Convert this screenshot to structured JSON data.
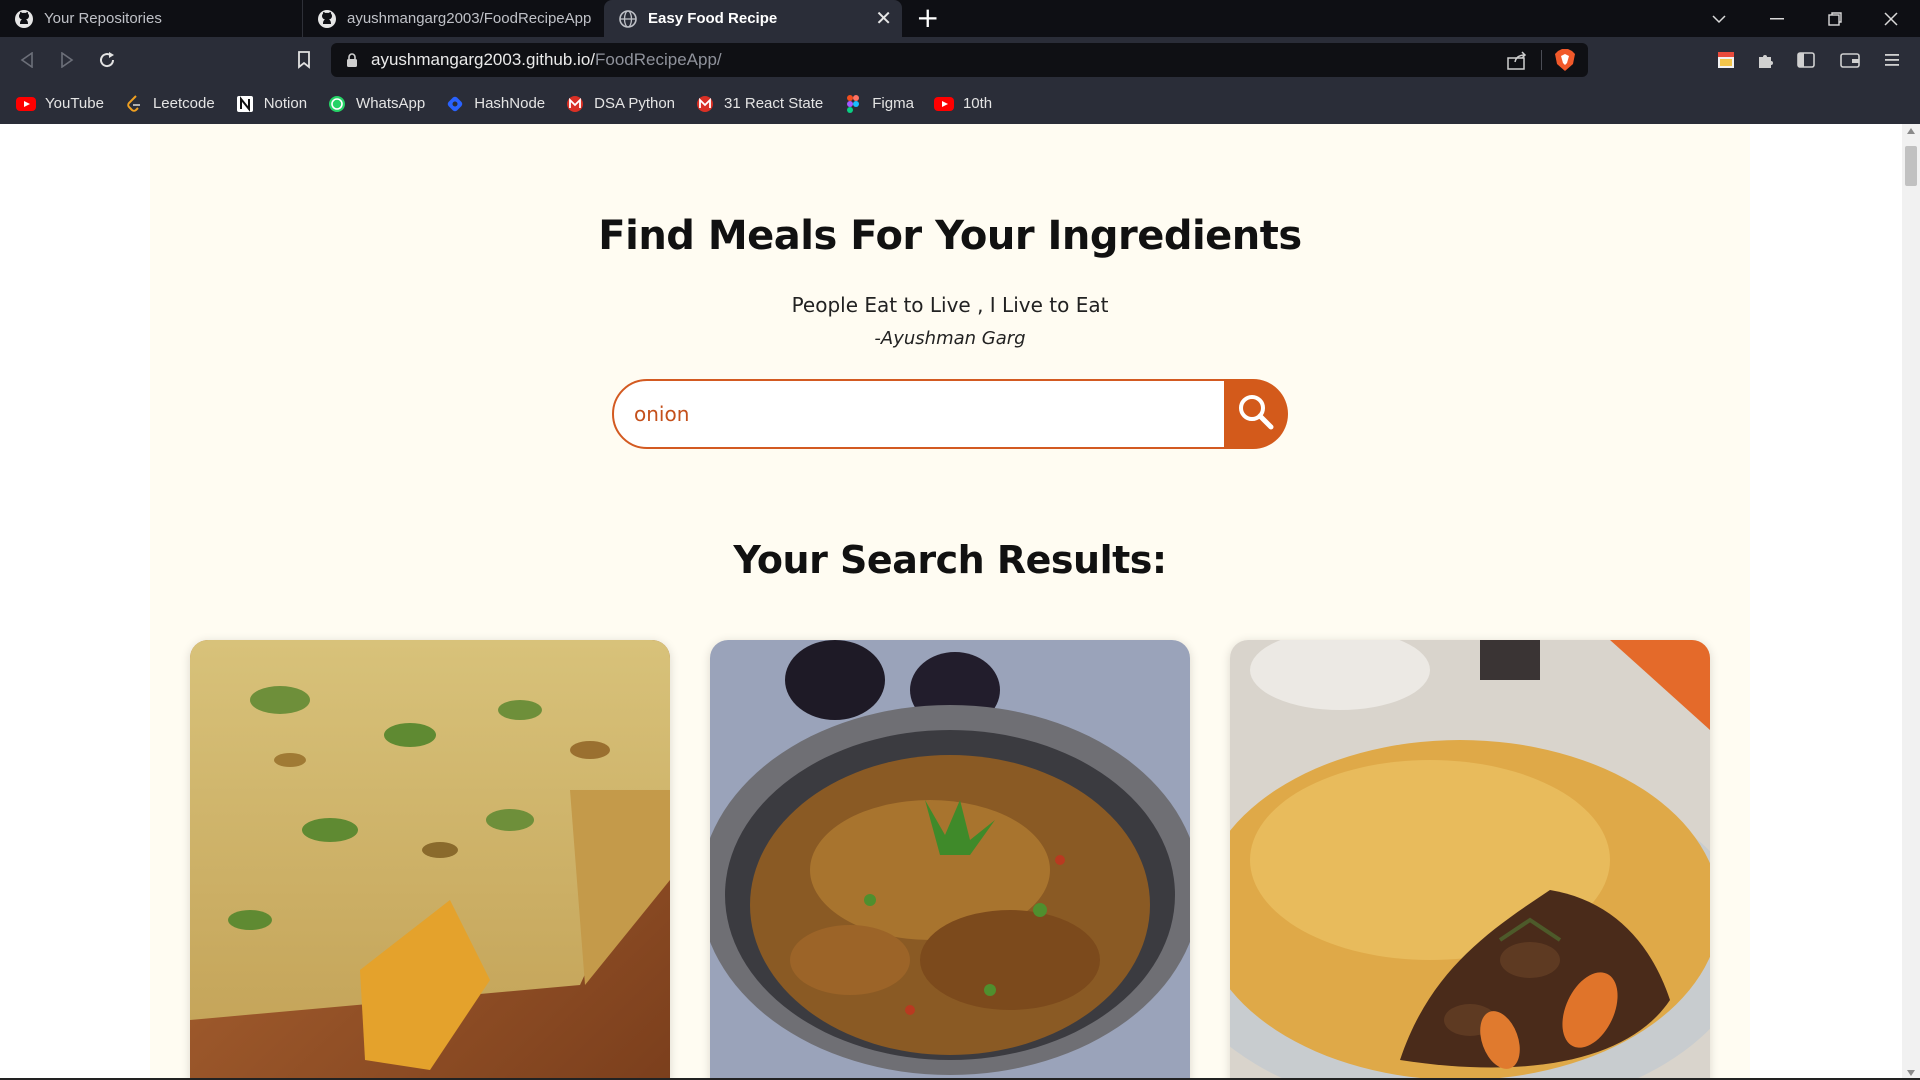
{
  "browser": {
    "tabs": [
      {
        "title": "Your Repositories",
        "icon": "github-icon",
        "active": false
      },
      {
        "title": "ayushmangarg2003/FoodRecipeApp",
        "icon": "github-icon",
        "active": false
      },
      {
        "title": "Easy Food Recipe",
        "icon": "globe-icon",
        "active": true
      }
    ],
    "new_tab_label": "+",
    "close_tab_label": "✕",
    "url_host": "ayushmangarg2003.github.io/",
    "url_path": "FoodRecipeApp/",
    "bookmarks": [
      {
        "label": "YouTube",
        "icon": "youtube-icon"
      },
      {
        "label": "Leetcode",
        "icon": "leetcode-icon"
      },
      {
        "label": "Notion",
        "icon": "notion-icon"
      },
      {
        "label": "WhatsApp",
        "icon": "whatsapp-icon"
      },
      {
        "label": "HashNode",
        "icon": "hashnode-icon"
      },
      {
        "label": "DSA Python",
        "icon": "gmail-icon"
      },
      {
        "label": "31 React State",
        "icon": "gmail-icon"
      },
      {
        "label": "Figma",
        "icon": "figma-icon"
      },
      {
        "label": "10th",
        "icon": "youtube-icon"
      }
    ]
  },
  "page": {
    "title": "Find Meals For Your Ingredients",
    "quote": "People Eat to Live , I Live to Eat",
    "author": "-Ayushman Garg",
    "search": {
      "value": "onion",
      "placeholder": ""
    },
    "results_title": "Your Search Results:",
    "results": [
      {
        "image": "baked-vegetable-frittata"
      },
      {
        "image": "eggplant-curry-in-bowl"
      },
      {
        "image": "beef-pot-pie"
      }
    ]
  },
  "colors": {
    "accent": "#d35a1b",
    "page_bg": "#fffcf2",
    "chrome_dark": "#0e0f14",
    "chrome": "#2a2d38"
  }
}
